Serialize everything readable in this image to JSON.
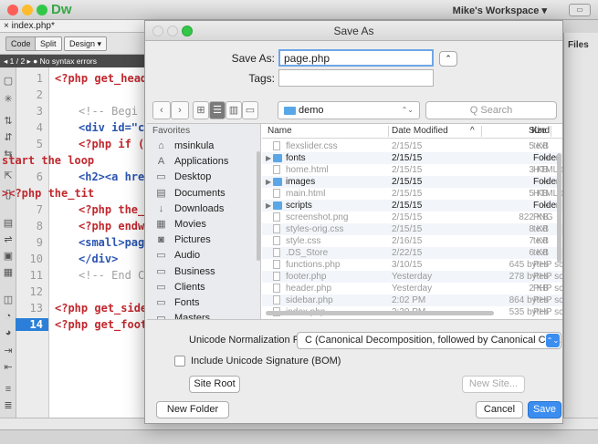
{
  "app": {
    "logo": "Dw",
    "workspace": "Mike's Workspace",
    "workspace_arrow": "▾",
    "workspace_btn": "▭",
    "doc_tab": "× index.php*",
    "view_code": "Code",
    "view_split": "Split",
    "view_design": "Design ▾",
    "status": "◂ 1 / 2 ▸ ● No syntax errors",
    "files_tab": "Files"
  },
  "code": {
    "line_numbers": [
      "1",
      "2",
      "3",
      "4",
      "5",
      "",
      "6",
      "",
      "7",
      "8",
      "9",
      "10",
      "11",
      "12",
      "13",
      "14"
    ],
    "lines": {
      "l1": "<?php get_head",
      "l3": "<!-- Begi",
      "l4": "<div id=\"c",
      "l5": "<?php if (",
      "l5b": "start the loop",
      "l6": "<h2><a hre",
      "l6b": "><?php the_tit",
      "l7": "<?php the_",
      "l8": "<?php endw",
      "l9": "<small>pag",
      "l10": "</div>",
      "l11": "<!-- End C",
      "l13": "<?php get_side",
      "l14": "<?php get_foot"
    }
  },
  "dialog": {
    "title": "Save As",
    "save_as_label": "Save As:",
    "save_as_value": "page.php",
    "tags_label": "Tags:",
    "tags_value": "",
    "expand_btn": "⌃",
    "back_btn": "‹",
    "forward_btn": "›",
    "view_icons": "⊞",
    "view_list": "☰",
    "view_columns": "▥",
    "view_cover": "▭",
    "view_group": "⊞ ▾",
    "location": "demo",
    "location_arrow": "⌃⌄",
    "search_placeholder": "Q Search",
    "favorites_label": "Favorites",
    "favorites": [
      {
        "icon": "⌂",
        "label": "msinkula"
      },
      {
        "icon": "A",
        "label": "Applications"
      },
      {
        "icon": "▭",
        "label": "Desktop"
      },
      {
        "icon": "▤",
        "label": "Documents"
      },
      {
        "icon": "↓",
        "label": "Downloads"
      },
      {
        "icon": "▦",
        "label": "Movies"
      },
      {
        "icon": "◙",
        "label": "Pictures"
      },
      {
        "icon": "▭",
        "label": "Audio"
      },
      {
        "icon": "▭",
        "label": "Business"
      },
      {
        "icon": "▭",
        "label": "Clients"
      },
      {
        "icon": "▭",
        "label": "Fonts"
      },
      {
        "icon": "▭",
        "label": "Masters"
      }
    ],
    "columns": {
      "name": "Name",
      "date": "Date Modified",
      "sort": "^",
      "size": "Size",
      "kind": "Kind"
    },
    "files": [
      {
        "name": "flexslider.css",
        "date": "2/15/15",
        "size": "5 KB",
        "kind": "text",
        "folder": false
      },
      {
        "name": "fonts",
        "date": "2/15/15",
        "size": "--",
        "kind": "Folder",
        "folder": true
      },
      {
        "name": "home.html",
        "date": "2/15/15",
        "size": "3 KB",
        "kind": "HTML t",
        "folder": false
      },
      {
        "name": "images",
        "date": "2/15/15",
        "size": "--",
        "kind": "Folder",
        "folder": true
      },
      {
        "name": "main.html",
        "date": "2/15/15",
        "size": "5 KB",
        "kind": "HTML t",
        "folder": false
      },
      {
        "name": "scripts",
        "date": "2/15/15",
        "size": "--",
        "kind": "Folder",
        "folder": true
      },
      {
        "name": "screenshot.png",
        "date": "2/15/15",
        "size": "822 KB",
        "kind": "PNG",
        "folder": false
      },
      {
        "name": "styles-orig.css",
        "date": "2/15/15",
        "size": "8 KB",
        "kind": "text",
        "folder": false
      },
      {
        "name": "style.css",
        "date": "2/16/15",
        "size": "7 KB",
        "kind": "text",
        "folder": false
      },
      {
        "name": ".DS_Store",
        "date": "2/22/15",
        "size": "6 KB",
        "kind": "text",
        "folder": false
      },
      {
        "name": "functions.php",
        "date": "3/10/15",
        "size": "645 bytes",
        "kind": "PHP scr",
        "folder": false
      },
      {
        "name": "footer.php",
        "date": "Yesterday",
        "size": "278 bytes",
        "kind": "PHP scr",
        "folder": false
      },
      {
        "name": "header.php",
        "date": "Yesterday",
        "size": "2 KB",
        "kind": "PHP scr",
        "folder": false
      },
      {
        "name": "sidebar.php",
        "date": "2:02 PM",
        "size": "864 bytes",
        "kind": "PHP scr",
        "folder": false
      },
      {
        "name": "index.php",
        "date": "2:30 PM",
        "size": "535 bytes",
        "kind": "PHP scr",
        "folder": false
      }
    ],
    "unicode_label": "Unicode Normalization Form:",
    "unicode_value": "C (Canonical Decomposition, followed by Canonical Com...",
    "unicode_arrow": "⌃⌄",
    "bom_label": "Include Unicode Signature (BOM)",
    "site_root": "Site Root",
    "new_site": "New Site...",
    "new_folder": "New Folder",
    "cancel": "Cancel",
    "save": "Save"
  },
  "colors": {
    "accent": "#3b8ef0",
    "php_keyword": "#c0282e",
    "html_tag": "#2a55b0",
    "close": "#fc5f57",
    "minimize": "#fdbc2e",
    "zoom": "#33c748"
  }
}
